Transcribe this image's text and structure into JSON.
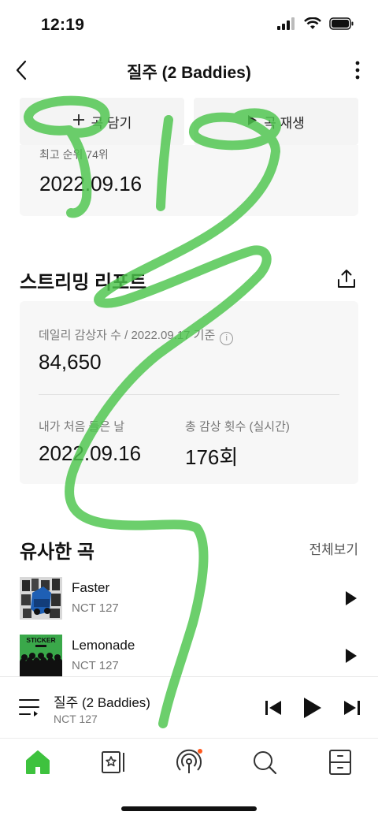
{
  "status": {
    "time": "12:19"
  },
  "nav": {
    "title": "질주 (2 Baddies)"
  },
  "actions": {
    "add_label": "곡 담기",
    "play_label": "곡 재생"
  },
  "chart_card": {
    "peak_label": "최고 순위 74위",
    "peak_date": "2022.09.16"
  },
  "report": {
    "title": "스트리밍 리포트",
    "daily_listeners_label": "데일리 감상자 수 / 2022.09.17 기준",
    "daily_listeners_value": "84,650",
    "first_listen_label": "내가 처음 들은 날",
    "first_listen_value": "2022.09.16",
    "total_plays_label": "총 감상 횟수 (실시간)",
    "total_plays_value": "176회"
  },
  "similar": {
    "title": "유사한 곡",
    "see_all": "전체보기",
    "songs": [
      {
        "title": "Faster",
        "artist": "NCT 127"
      },
      {
        "title": "Lemonade",
        "artist": "NCT 127"
      }
    ],
    "album_text": "STICKER"
  },
  "mini_player": {
    "title": "질주 (2 Baddies)",
    "artist": "NCT 127"
  },
  "colors": {
    "accent": "#3ec23e",
    "scribble": "#4cc44c",
    "notification_dot": "#ff5a1f"
  }
}
